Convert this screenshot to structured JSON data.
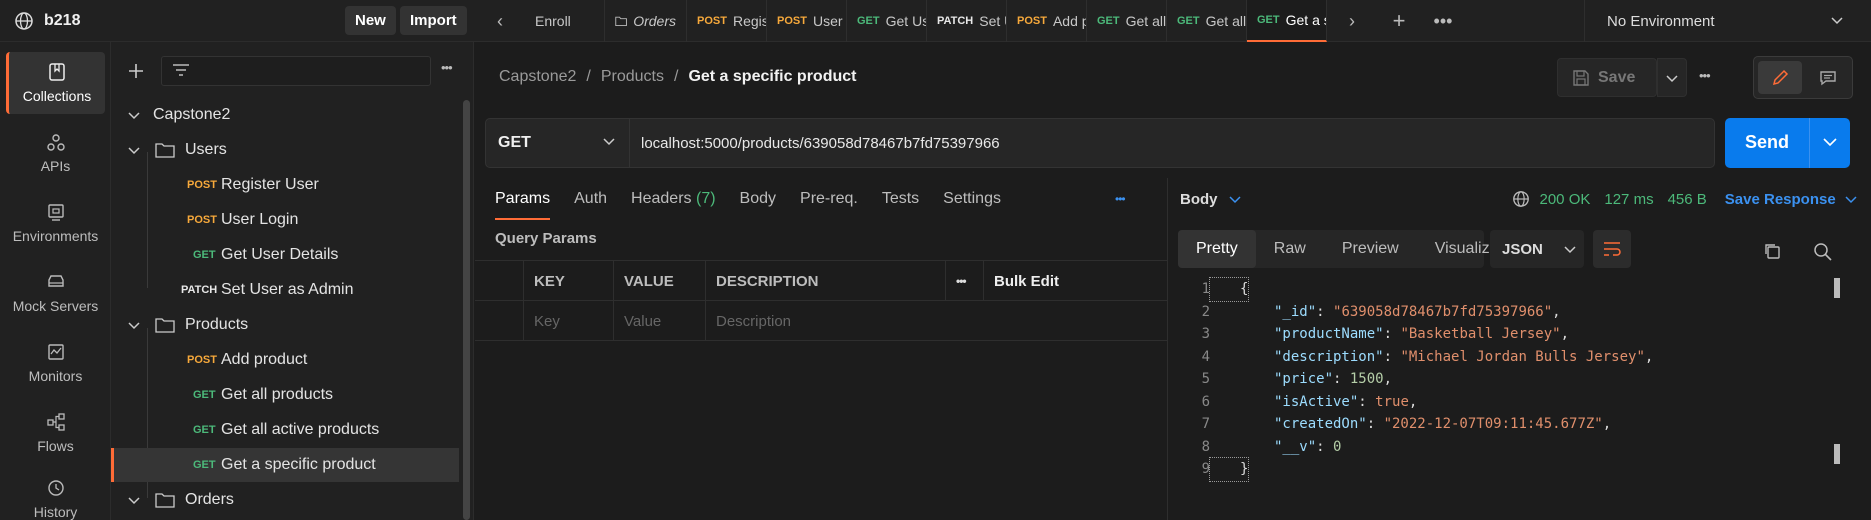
{
  "workspace": {
    "name": "b218",
    "new_label": "New",
    "import_label": "Import"
  },
  "tabs": [
    {
      "method": "",
      "label": "Enroll"
    },
    {
      "method": "",
      "label": "Orders",
      "folder": true
    },
    {
      "method": "POST",
      "label": "Regis"
    },
    {
      "method": "POST",
      "label": "User l"
    },
    {
      "method": "GET",
      "label": "Get Us"
    },
    {
      "method": "PATCH",
      "label": "Set U"
    },
    {
      "method": "POST",
      "label": "Add p"
    },
    {
      "method": "GET",
      "label": "Get all"
    },
    {
      "method": "GET",
      "label": "Get all"
    },
    {
      "method": "GET",
      "label": "Get a s"
    }
  ],
  "environment": {
    "label": "No Environment"
  },
  "rail": {
    "items": [
      {
        "label": "Collections",
        "icon": "collections-icon"
      },
      {
        "label": "APIs",
        "icon": "apis-icon"
      },
      {
        "label": "Environments",
        "icon": "environments-icon"
      },
      {
        "label": "Mock Servers",
        "icon": "mock-servers-icon"
      },
      {
        "label": "Monitors",
        "icon": "monitors-icon"
      },
      {
        "label": "Flows",
        "icon": "flows-icon"
      },
      {
        "label": "History",
        "icon": "history-icon"
      }
    ]
  },
  "tree": {
    "collection": "Capstone2",
    "folders": {
      "users": "Users",
      "products": "Products",
      "orders": "Orders"
    },
    "requests": [
      {
        "method": "POST",
        "label": "Register User"
      },
      {
        "method": "POST",
        "label": "User Login"
      },
      {
        "method": "GET",
        "label": "Get User Details"
      },
      {
        "method": "PATCH",
        "label": "Set User as Admin"
      },
      {
        "method": "POST",
        "label": "Add product"
      },
      {
        "method": "GET",
        "label": "Get all products"
      },
      {
        "method": "GET",
        "label": "Get all active products"
      },
      {
        "method": "GET",
        "label": "Get a specific product"
      }
    ]
  },
  "breadcrumb": {
    "collection": "Capstone2",
    "folder": "Products",
    "current": "Get a specific product",
    "sep": "/"
  },
  "toolbar": {
    "save_label": "Save"
  },
  "request": {
    "method": "GET",
    "url": "localhost:5000/products/639058d78467b7fd75397966",
    "send_label": "Send",
    "tabs": {
      "params": "Params",
      "auth": "Auth",
      "headers": "Headers",
      "headers_count": "(7)",
      "body": "Body",
      "prereq": "Pre-req.",
      "tests": "Tests",
      "settings": "Settings"
    },
    "query_title": "Query Params",
    "table": {
      "key": "KEY",
      "value": "VALUE",
      "description": "DESCRIPTION",
      "bulk_edit": "Bulk Edit",
      "ph_key": "Key",
      "ph_value": "Value",
      "ph_description": "Description"
    }
  },
  "response": {
    "section": "Body",
    "status": "200 OK",
    "time": "127 ms",
    "size": "456 B",
    "save_label": "Save Response",
    "tabs": {
      "pretty": "Pretty",
      "raw": "Raw",
      "preview": "Preview",
      "visualize": "Visualize"
    },
    "format": "JSON",
    "lines": [
      {
        "n": "1",
        "key": "",
        "val": "",
        "raw": "{"
      },
      {
        "n": "2",
        "key": "\"_id\"",
        "val": "\"639058d78467b7fd75397966\"",
        "type": "s"
      },
      {
        "n": "3",
        "key": "\"productName\"",
        "val": "\"Basketball Jersey\"",
        "type": "s"
      },
      {
        "n": "4",
        "key": "\"description\"",
        "val": "\"Michael Jordan Bulls Jersey\"",
        "type": "s"
      },
      {
        "n": "5",
        "key": "\"price\"",
        "val": "1500",
        "type": "n"
      },
      {
        "n": "6",
        "key": "\"isActive\"",
        "val": "true",
        "type": "b"
      },
      {
        "n": "7",
        "key": "\"createdOn\"",
        "val": "\"2022-12-07T09:11:45.677Z\"",
        "type": "s"
      },
      {
        "n": "8",
        "key": "\"__v\"",
        "val": "0",
        "type": "n",
        "last": true
      },
      {
        "n": "9",
        "key": "",
        "val": "",
        "raw": "}"
      }
    ]
  }
}
